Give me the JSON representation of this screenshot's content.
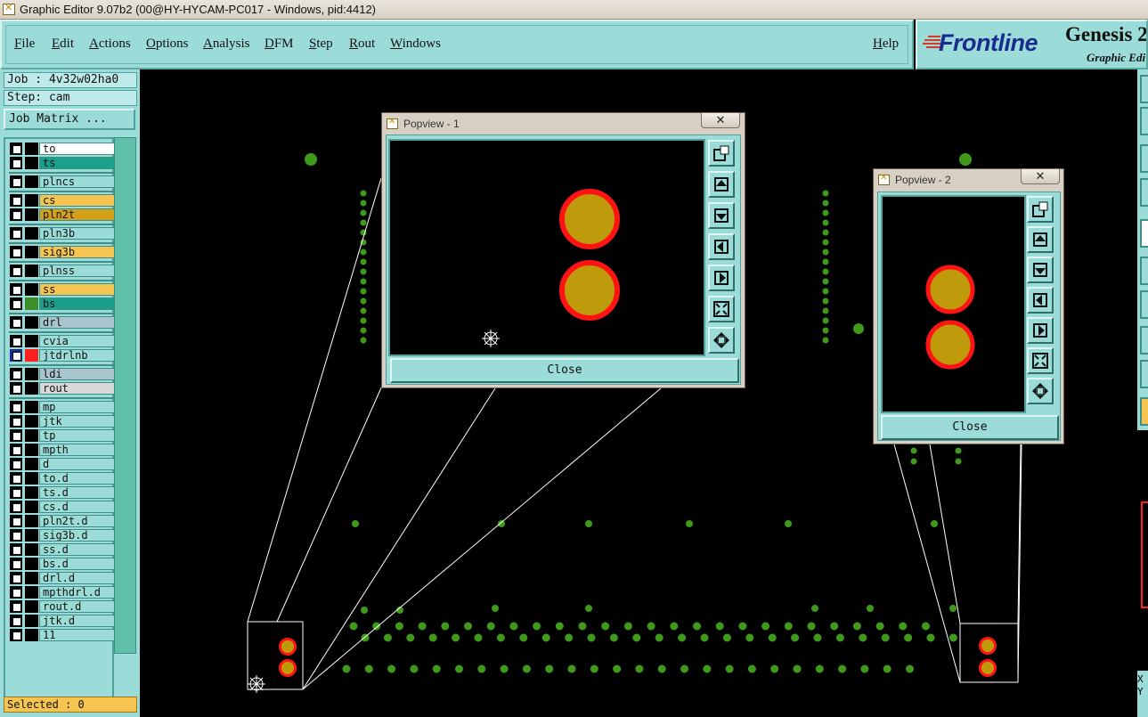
{
  "window": {
    "title": "Graphic Editor 9.07b2 (00@HY-HYCAM-PC017 - Windows, pid:4412)"
  },
  "menu": {
    "file": "File",
    "edit": "Edit",
    "actions": "Actions",
    "options": "Options",
    "analysis": "Analysis",
    "dfm": "DFM",
    "step": "Step",
    "rout": "Rout",
    "windows": "Windows",
    "help": "Help"
  },
  "logo": {
    "brand": "Frontline",
    "product": "Genesis 2",
    "subtitle": "Graphic Edi"
  },
  "left": {
    "job": "Job : 4v32w02ha0",
    "step": "Step: cam",
    "job_matrix": "Job Matrix ...",
    "selected": "Selected : 0"
  },
  "layers": [
    {
      "name": "to",
      "color": "#ffffff",
      "swatch": "#000000"
    },
    {
      "name": "ts",
      "color": "#1aa08a",
      "swatch": "#000000"
    },
    {
      "name": "plncs",
      "color": "#9cdcd8",
      "swatch": "#000000"
    },
    {
      "name": "cs",
      "color": "#f5c451",
      "swatch": "#000000"
    },
    {
      "name": "pln2t",
      "color": "#d4a017",
      "swatch": "#000000"
    },
    {
      "name": "pln3b",
      "color": "#9cdcd8",
      "swatch": "#000000"
    },
    {
      "name": "sig3b",
      "color": "#f5c451",
      "swatch": "#000000"
    },
    {
      "name": "plnss",
      "color": "#9cdcd8",
      "swatch": "#000000"
    },
    {
      "name": "ss",
      "color": "#f5c451",
      "swatch": "#000000"
    },
    {
      "name": "bs",
      "color": "#1aa08a",
      "swatch": "#3a8f2a"
    },
    {
      "name": "drl",
      "color": "#a8c4cc",
      "swatch": "#000000"
    },
    {
      "name": "cvia",
      "color": "#9cdcd8",
      "swatch": "#000000"
    },
    {
      "name": "jtdrlnb",
      "color": "#9cdcd8",
      "swatch": "#ff2020"
    },
    {
      "name": "ldi",
      "color": "#a8c4cc",
      "swatch": "#000000"
    },
    {
      "name": "rout",
      "color": "#d8d8d8",
      "swatch": "#000000"
    },
    {
      "name": "mp",
      "color": "#9cdcd8",
      "swatch": "#000000"
    },
    {
      "name": "jtk",
      "color": "#9cdcd8",
      "swatch": "#000000"
    },
    {
      "name": "tp",
      "color": "#9cdcd8",
      "swatch": "#000000"
    },
    {
      "name": "mpth",
      "color": "#9cdcd8",
      "swatch": "#000000"
    },
    {
      "name": "d",
      "color": "#9cdcd8",
      "swatch": "#000000"
    },
    {
      "name": "to.d",
      "color": "#9cdcd8",
      "swatch": "#000000"
    },
    {
      "name": "ts.d",
      "color": "#9cdcd8",
      "swatch": "#000000"
    },
    {
      "name": "cs.d",
      "color": "#9cdcd8",
      "swatch": "#000000"
    },
    {
      "name": "pln2t.d",
      "color": "#9cdcd8",
      "swatch": "#000000"
    },
    {
      "name": "sig3b.d",
      "color": "#9cdcd8",
      "swatch": "#000000"
    },
    {
      "name": "ss.d",
      "color": "#9cdcd8",
      "swatch": "#000000"
    },
    {
      "name": "bs.d",
      "color": "#9cdcd8",
      "swatch": "#000000"
    },
    {
      "name": "drl.d",
      "color": "#9cdcd8",
      "swatch": "#000000"
    },
    {
      "name": "mpthdrl.d",
      "color": "#9cdcd8",
      "swatch": "#000000"
    },
    {
      "name": "rout.d",
      "color": "#9cdcd8",
      "swatch": "#000000"
    },
    {
      "name": "jtk.d",
      "color": "#9cdcd8",
      "swatch": "#000000"
    },
    {
      "name": "11",
      "color": "#9cdcd8",
      "swatch": "#000000"
    }
  ],
  "popview1": {
    "title": "Popview - 1",
    "close_label": "Close"
  },
  "popview2": {
    "title": "Popview - 2",
    "close_label": "Close"
  },
  "colors": {
    "pad_fill": "#bf9a0a",
    "pad_ring": "#ff1414",
    "via": "#3f9a1a",
    "panel": "#9cdcd8"
  }
}
